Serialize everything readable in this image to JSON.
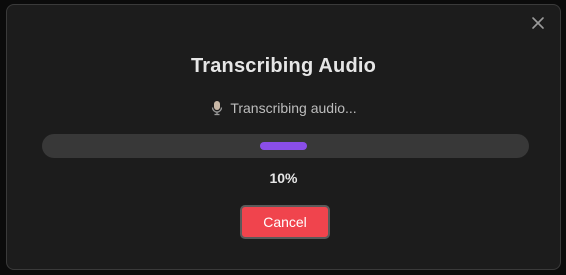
{
  "dialog": {
    "title": "Transcribing Audio",
    "status_icon": "microphone-icon",
    "status_text": "Transcribing audio...",
    "progress": {
      "value": 0.1,
      "label": "10%",
      "color": "#8a4ee8"
    },
    "cancel_label": "Cancel",
    "cancel_color": "#f0444d",
    "close_icon": "close-icon"
  }
}
